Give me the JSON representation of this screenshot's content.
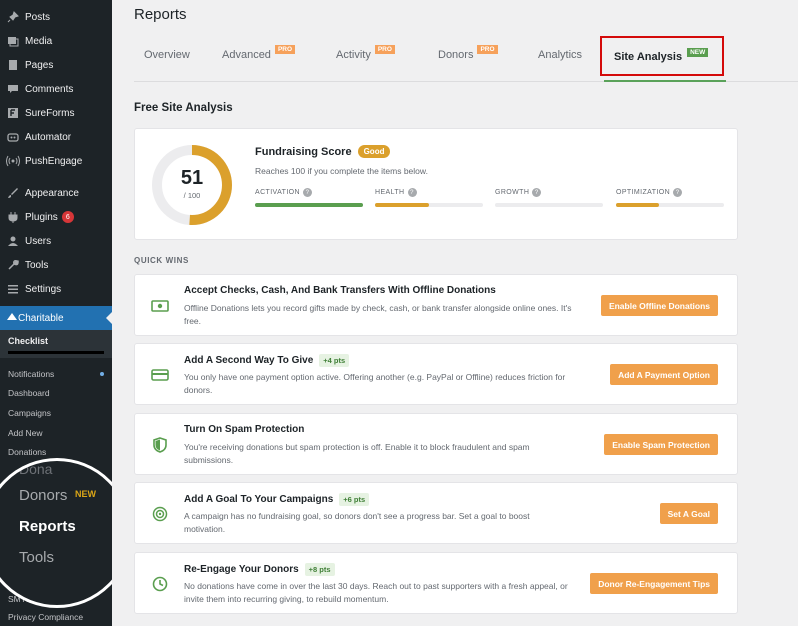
{
  "sidebar": {
    "items": [
      {
        "label": "Posts",
        "icon": "pin-icon"
      },
      {
        "label": "Media",
        "icon": "media-icon"
      },
      {
        "label": "Pages",
        "icon": "pages-icon"
      },
      {
        "label": "Comments",
        "icon": "comment-icon"
      },
      {
        "label": "SureForms",
        "icon": "sureforms-icon"
      },
      {
        "label": "Automator",
        "icon": "automator-icon"
      },
      {
        "label": "PushEngage",
        "icon": "broadcast-icon"
      }
    ],
    "items2": [
      {
        "label": "Appearance",
        "icon": "brush-icon"
      },
      {
        "label": "Plugins",
        "icon": "plugin-icon",
        "badge": "6"
      },
      {
        "label": "Users",
        "icon": "user-icon"
      },
      {
        "label": "Tools",
        "icon": "wrench-icon"
      },
      {
        "label": "Settings",
        "icon": "settings-icon"
      }
    ],
    "charitable": "Charitable",
    "checklist": "Checklist",
    "sub": [
      "Notifications",
      "Dashboard",
      "Campaigns",
      "Add New",
      "Donations"
    ],
    "bottom": [
      "SMTP",
      "Privacy Compliance"
    ],
    "magnifier": {
      "donors": "Donors",
      "reports": "Reports",
      "tools": "Tools",
      "new": "NEW"
    }
  },
  "main": {
    "title": "Reports",
    "tabs": [
      {
        "label": "Overview"
      },
      {
        "label": "Advanced",
        "tag": "PRO"
      },
      {
        "label": "Activity",
        "tag": "PRO"
      },
      {
        "label": "Donors",
        "tag": "PRO"
      },
      {
        "label": "Analytics"
      },
      {
        "label": "Site Analysis",
        "tag": "NEW"
      }
    ],
    "section_title": "Free Site Analysis",
    "score": {
      "value": "51",
      "denominator": "/ 100",
      "fraction": 0.51,
      "title": "Fundraising Score",
      "badge": "Good",
      "subtitle": "Reaches 100 if you complete the items below.",
      "metrics": [
        {
          "label": "ACTIVATION",
          "fraction": 1.0,
          "color": "#5a9e4f"
        },
        {
          "label": "HEALTH",
          "fraction": 0.5,
          "color": "#dba02c"
        },
        {
          "label": "GROWTH",
          "fraction": 0.0,
          "color": "#dba02c"
        },
        {
          "label": "OPTIMIZATION",
          "fraction": 0.4,
          "color": "#dba02c"
        }
      ]
    },
    "quick_wins_title": "QUICK WINS",
    "quick_wins": [
      {
        "icon": "cash-icon",
        "title": "Accept Checks, Cash, And Bank Transfers With Offline Donations",
        "pts": "",
        "desc": "Offline Donations lets you record gifts made by check, cash, or bank transfer alongside online ones. It's free.",
        "button": "Enable Offline Donations"
      },
      {
        "icon": "credit-card-icon",
        "title": "Add A Second Way To Give",
        "pts": "+4 pts",
        "desc": "You only have one payment option active. Offering another (e.g. PayPal or Offline) reduces friction for donors.",
        "button": "Add A Payment Option"
      },
      {
        "icon": "shield-icon",
        "title": "Turn On Spam Protection",
        "pts": "",
        "desc": "You're receiving donations but spam protection is off. Enable it to block fraudulent and spam submissions.",
        "button": "Enable Spam Protection"
      },
      {
        "icon": "target-icon",
        "title": "Add A Goal To Your Campaigns",
        "pts": "+6 pts",
        "desc": "A campaign has no fundraising goal, so donors don't see a progress bar. Set a goal to boost motivation.",
        "button": "Set A Goal"
      },
      {
        "icon": "clock-icon",
        "title": "Re-Engage Your Donors",
        "pts": "+8 pts",
        "desc": "No donations have come in over the last 30 days. Reach out to past supporters with a fresh appeal, or invite them into recurring giving, to rebuild momentum.",
        "button": "Donor Re-Engagement Tips"
      }
    ]
  }
}
